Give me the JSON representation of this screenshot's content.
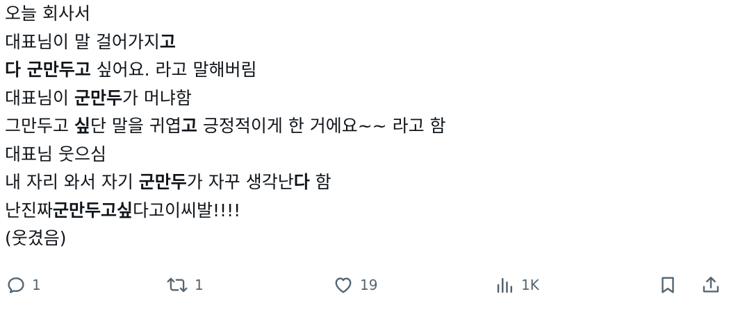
{
  "post": {
    "lines": [
      [
        {
          "t": "오늘 회사서",
          "b": false
        }
      ],
      [
        {
          "t": "대표님이 말 걸어가지",
          "b": false
        },
        {
          "t": "고",
          "b": true
        }
      ],
      [
        {
          "t": "다 군만두고",
          "b": true
        },
        {
          "t": " 싶어요. 라고 말해버림",
          "b": false
        }
      ],
      [
        {
          "t": "대표님이 ",
          "b": false
        },
        {
          "t": "군만두",
          "b": true
        },
        {
          "t": "가 머냐함",
          "b": false
        }
      ],
      [
        {
          "t": "그만두고 ",
          "b": false
        },
        {
          "t": "싶",
          "b": true
        },
        {
          "t": "단 말을 귀엽",
          "b": false
        },
        {
          "t": "고",
          "b": true
        },
        {
          "t": " 긍정적이게 한 거에요~~ 라고 함",
          "b": false
        }
      ],
      [
        {
          "t": "대표님 웃으심",
          "b": false
        }
      ],
      [
        {
          "t": "내 자리 와서 자기 ",
          "b": false
        },
        {
          "t": "군만두",
          "b": true
        },
        {
          "t": "가 자꾸 생각난",
          "b": false
        },
        {
          "t": "다",
          "b": true
        },
        {
          "t": " 함",
          "b": false
        }
      ],
      [
        {
          "t": "난진짜",
          "b": false
        },
        {
          "t": "군만두고싶",
          "b": true
        },
        {
          "t": "다고이씨발!!!!",
          "b": false
        }
      ],
      [
        {
          "t": "(웃겼음)",
          "b": false
        }
      ]
    ]
  },
  "actions": {
    "reply": {
      "icon": "reply-icon",
      "count": "1"
    },
    "repost": {
      "icon": "repost-icon",
      "count": "1"
    },
    "like": {
      "icon": "heart-icon",
      "count": "19"
    },
    "views": {
      "icon": "views-icon",
      "count": "1K"
    },
    "bookmark": {
      "icon": "bookmark-icon"
    },
    "share": {
      "icon": "share-icon"
    }
  },
  "colors": {
    "text": "#0f1419",
    "muted": "#536471",
    "background": "#ffffff"
  }
}
